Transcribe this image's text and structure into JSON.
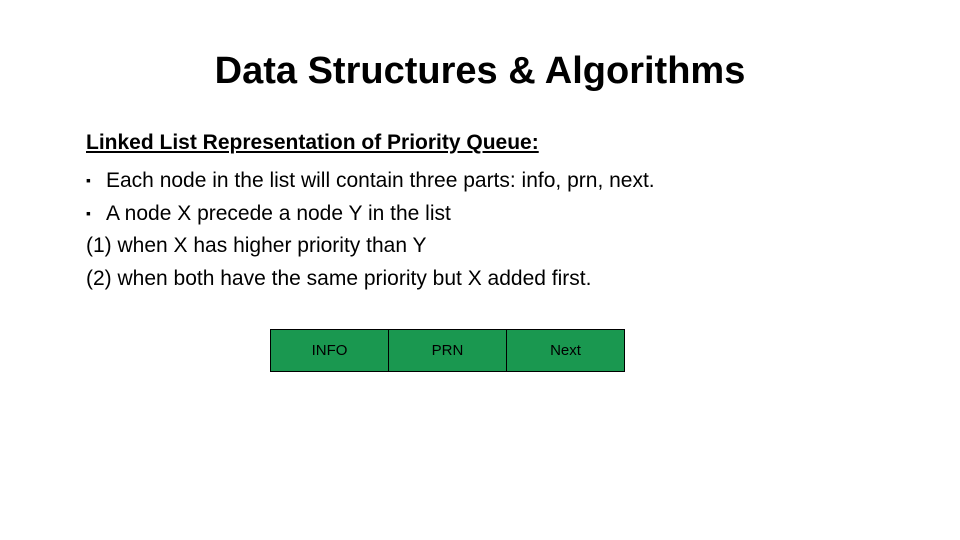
{
  "title": "Data Structures & Algorithms",
  "subtitle": "Linked List Representation of Priority Queue:",
  "lines": {
    "l1": "Each node in the list will contain three parts: info, prn, next.",
    "l2": "A node X precede a node Y in the list",
    "l3": "(1) when X has higher priority than Y",
    "l4": "(2) when both have the same priority but X added first."
  },
  "node": {
    "c1": "INFO",
    "c2": "PRN",
    "c3": "Next"
  }
}
